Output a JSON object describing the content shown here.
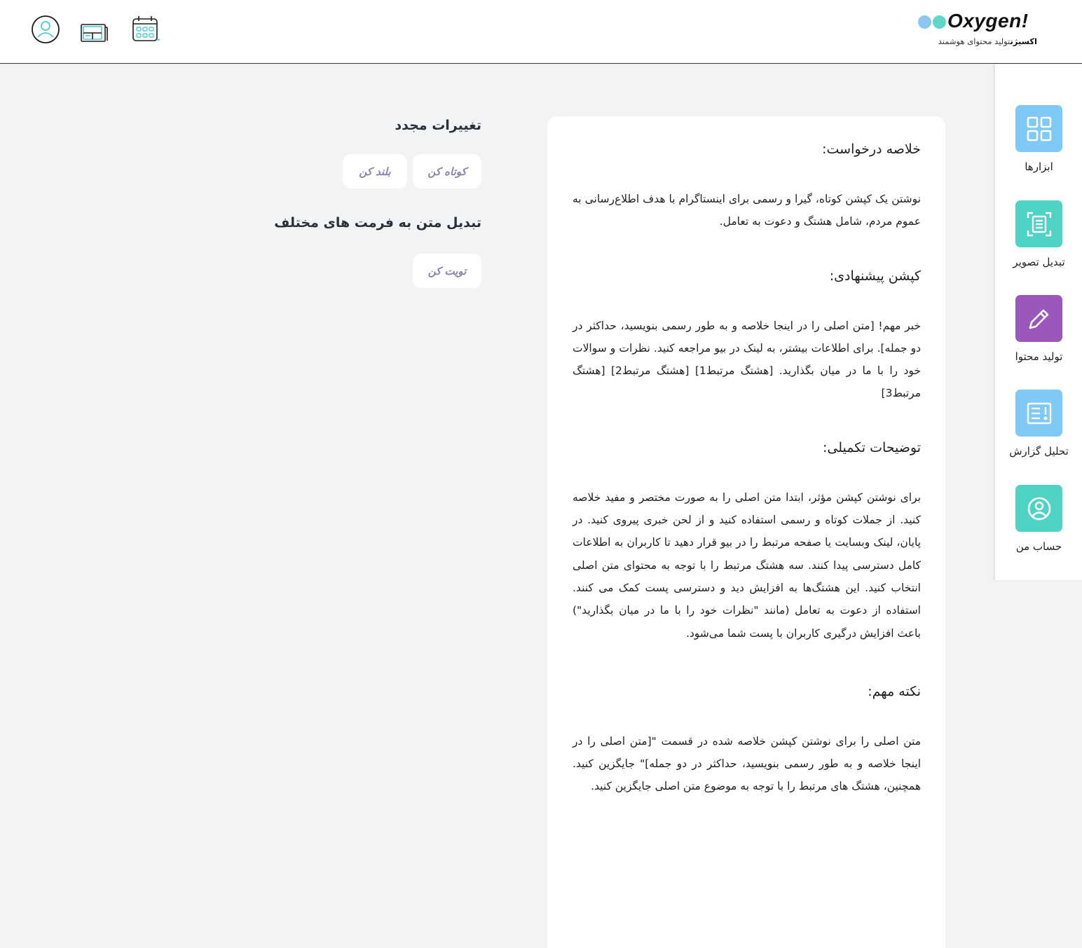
{
  "brand": {
    "name": "Oxygen!",
    "tagline_bold": "اکسیژن",
    "tagline": "تولید محتوای هوشمند",
    "dot_colors": [
      "#8cc6f2",
      "#5fd6c8",
      "#7b3fa8"
    ]
  },
  "header_icons": [
    "calendar-icon",
    "layout-icon",
    "user-circle-icon"
  ],
  "sidebar": {
    "items": [
      {
        "label": "ابزارها",
        "icon": "grid-icon",
        "color": "#7ec9f5"
      },
      {
        "label": "تبدیل تصویر",
        "icon": "scan-document-icon",
        "color": "#4fd3c4"
      },
      {
        "label": "تولید محتوا",
        "icon": "pencil-icon",
        "color": "#9a58bd"
      },
      {
        "label": "تحلیل گزارش",
        "icon": "report-icon",
        "color": "#7ec9f5"
      },
      {
        "label": "حساب من",
        "icon": "user-circle-icon",
        "color": "#4fd3c4"
      }
    ]
  },
  "content": {
    "sections": [
      {
        "title": "خلاصه درخواست:",
        "body": "نوشتن یک کپشن کوتاه، گیرا و رسمی برای اینستاگرام با هدف اطلاع‌رسانی به عموم مردم، شامل هشتگ و دعوت به تعامل."
      },
      {
        "title": "کپشن پیشنهادی:",
        "body": "خبر مهم! [متن اصلی را در اینجا خلاصه و به طور رسمی بنویسید، حداکثر در دو جمله]. برای اطلاعات بیشتر، به لینک در بیو مراجعه کنید. نظرات و سوالات خود را با ما در میان بگذارید. [هشتگ مرتبط1] [هشتگ مرتبط2] [هشتگ مرتبط3]"
      },
      {
        "title": "توضیحات تکمیلی:",
        "body": "برای نوشتن کپشن مؤثر، ابتدا متن اصلی را به صورت مختصر و مفید خلاصه کنید. از جملات کوتاه و رسمی استفاده کنید و از لحن خبری پیروی کنید. در پایان، لینک وبسایت یا صفحه مرتبط را در بیو قرار دهید تا کاربران به اطلاعات کامل دسترسی پیدا کنند. سه هشتگ مرتبط را با توجه به محتوای متن اصلی انتخاب کنید. این هشتگ‌ها به افزایش دید و دسترسی پست کمک می کنند. استفاده از دعوت به تعامل (مانند \"نظرات خود را با ما در میان بگذارید\") باعث افزایش درگیری کاربران با پست شما می‌شود."
      },
      {
        "title": "نکته مهم:",
        "body": "متن اصلی را برای نوشتن کپشن خلاصه شده در قسمت \"[متن اصلی را در اینجا خلاصه و به طور رسمی بنویسید، حداکثر در دو جمله]\" جایگزین کنید. همچنین، هشتگ های مرتبط را با توجه به موضوع متن اصلی جایگزین کنید."
      }
    ]
  },
  "panel": {
    "revisions_title": "تغییرات مجدد",
    "shorten_label": "کوتاه کن",
    "lengthen_label": "بلند کن",
    "convert_title": "تبدیل متن به فرمت های مختلف",
    "tweet_label": "تویت کن"
  }
}
